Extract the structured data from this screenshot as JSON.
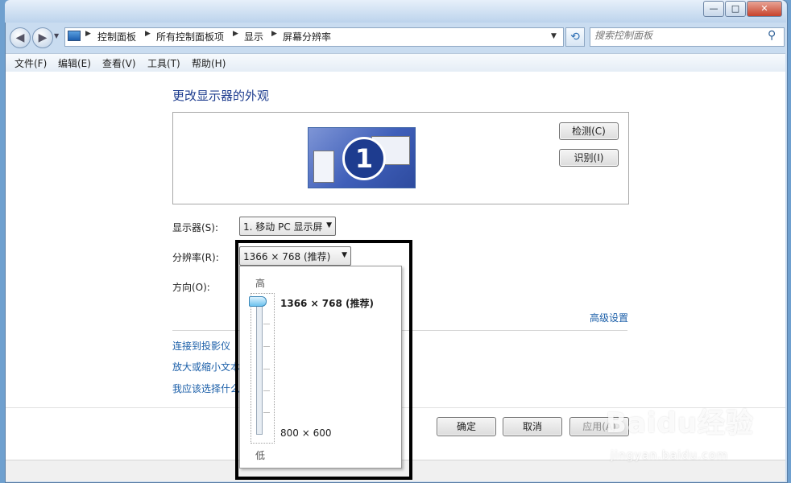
{
  "window": {
    "minimize_label": "—",
    "maximize_label": "□",
    "close_label": "✕"
  },
  "address": {
    "breadcrumbs": [
      "控制面板",
      "所有控制面板项",
      "显示",
      "屏幕分辨率"
    ],
    "search_placeholder": "搜索控制面板"
  },
  "menu": [
    "文件(F)",
    "编辑(E)",
    "查看(V)",
    "工具(T)",
    "帮助(H)"
  ],
  "main": {
    "title": "更改显示器的外观",
    "monitor_number": "1",
    "detect_button": "检测(C)",
    "identify_button": "识别(I)",
    "display_label": "显示器(S):",
    "display_value": "1. 移动 PC 显示屏",
    "resolution_label": "分辨率(R):",
    "resolution_value": "1366 × 768 (推荐)",
    "orientation_label": "方向(O):",
    "advanced_link": "高级设置",
    "links": [
      "连接到投影仪",
      "放大或缩小文本",
      "我应该选择什么"
    ],
    "ok_button": "确定",
    "cancel_button": "取消",
    "apply_button": "应用(A)"
  },
  "dropdown": {
    "high_label": "高",
    "low_label": "低",
    "top_option": "1366 × 768 (推荐)",
    "bottom_option": "800 × 600",
    "slider_level": 1.0
  },
  "watermark": {
    "brand": "Baidu经验",
    "url": "jingyan.baidu.com"
  },
  "colors": {
    "title": "#1e3d8f",
    "link": "#1a5ea8",
    "highlight_frame": "#000000"
  }
}
